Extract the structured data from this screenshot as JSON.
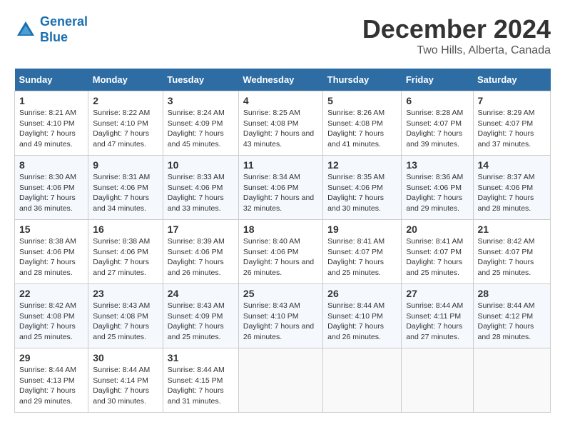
{
  "header": {
    "logo_line1": "General",
    "logo_line2": "Blue",
    "month": "December 2024",
    "location": "Two Hills, Alberta, Canada"
  },
  "days_of_week": [
    "Sunday",
    "Monday",
    "Tuesday",
    "Wednesday",
    "Thursday",
    "Friday",
    "Saturday"
  ],
  "weeks": [
    [
      {
        "day": "1",
        "sunrise": "8:21 AM",
        "sunset": "4:10 PM",
        "daylight": "7 hours and 49 minutes."
      },
      {
        "day": "2",
        "sunrise": "8:22 AM",
        "sunset": "4:10 PM",
        "daylight": "7 hours and 47 minutes."
      },
      {
        "day": "3",
        "sunrise": "8:24 AM",
        "sunset": "4:09 PM",
        "daylight": "7 hours and 45 minutes."
      },
      {
        "day": "4",
        "sunrise": "8:25 AM",
        "sunset": "4:08 PM",
        "daylight": "7 hours and 43 minutes."
      },
      {
        "day": "5",
        "sunrise": "8:26 AM",
        "sunset": "4:08 PM",
        "daylight": "7 hours and 41 minutes."
      },
      {
        "day": "6",
        "sunrise": "8:28 AM",
        "sunset": "4:07 PM",
        "daylight": "7 hours and 39 minutes."
      },
      {
        "day": "7",
        "sunrise": "8:29 AM",
        "sunset": "4:07 PM",
        "daylight": "7 hours and 37 minutes."
      }
    ],
    [
      {
        "day": "8",
        "sunrise": "8:30 AM",
        "sunset": "4:06 PM",
        "daylight": "7 hours and 36 minutes."
      },
      {
        "day": "9",
        "sunrise": "8:31 AM",
        "sunset": "4:06 PM",
        "daylight": "7 hours and 34 minutes."
      },
      {
        "day": "10",
        "sunrise": "8:33 AM",
        "sunset": "4:06 PM",
        "daylight": "7 hours and 33 minutes."
      },
      {
        "day": "11",
        "sunrise": "8:34 AM",
        "sunset": "4:06 PM",
        "daylight": "7 hours and 32 minutes."
      },
      {
        "day": "12",
        "sunrise": "8:35 AM",
        "sunset": "4:06 PM",
        "daylight": "7 hours and 30 minutes."
      },
      {
        "day": "13",
        "sunrise": "8:36 AM",
        "sunset": "4:06 PM",
        "daylight": "7 hours and 29 minutes."
      },
      {
        "day": "14",
        "sunrise": "8:37 AM",
        "sunset": "4:06 PM",
        "daylight": "7 hours and 28 minutes."
      }
    ],
    [
      {
        "day": "15",
        "sunrise": "8:38 AM",
        "sunset": "4:06 PM",
        "daylight": "7 hours and 28 minutes."
      },
      {
        "day": "16",
        "sunrise": "8:38 AM",
        "sunset": "4:06 PM",
        "daylight": "7 hours and 27 minutes."
      },
      {
        "day": "17",
        "sunrise": "8:39 AM",
        "sunset": "4:06 PM",
        "daylight": "7 hours and 26 minutes."
      },
      {
        "day": "18",
        "sunrise": "8:40 AM",
        "sunset": "4:06 PM",
        "daylight": "7 hours and 26 minutes."
      },
      {
        "day": "19",
        "sunrise": "8:41 AM",
        "sunset": "4:07 PM",
        "daylight": "7 hours and 25 minutes."
      },
      {
        "day": "20",
        "sunrise": "8:41 AM",
        "sunset": "4:07 PM",
        "daylight": "7 hours and 25 minutes."
      },
      {
        "day": "21",
        "sunrise": "8:42 AM",
        "sunset": "4:07 PM",
        "daylight": "7 hours and 25 minutes."
      }
    ],
    [
      {
        "day": "22",
        "sunrise": "8:42 AM",
        "sunset": "4:08 PM",
        "daylight": "7 hours and 25 minutes."
      },
      {
        "day": "23",
        "sunrise": "8:43 AM",
        "sunset": "4:08 PM",
        "daylight": "7 hours and 25 minutes."
      },
      {
        "day": "24",
        "sunrise": "8:43 AM",
        "sunset": "4:09 PM",
        "daylight": "7 hours and 25 minutes."
      },
      {
        "day": "25",
        "sunrise": "8:43 AM",
        "sunset": "4:10 PM",
        "daylight": "7 hours and 26 minutes."
      },
      {
        "day": "26",
        "sunrise": "8:44 AM",
        "sunset": "4:10 PM",
        "daylight": "7 hours and 26 minutes."
      },
      {
        "day": "27",
        "sunrise": "8:44 AM",
        "sunset": "4:11 PM",
        "daylight": "7 hours and 27 minutes."
      },
      {
        "day": "28",
        "sunrise": "8:44 AM",
        "sunset": "4:12 PM",
        "daylight": "7 hours and 28 minutes."
      }
    ],
    [
      {
        "day": "29",
        "sunrise": "8:44 AM",
        "sunset": "4:13 PM",
        "daylight": "7 hours and 29 minutes."
      },
      {
        "day": "30",
        "sunrise": "8:44 AM",
        "sunset": "4:14 PM",
        "daylight": "7 hours and 30 minutes."
      },
      {
        "day": "31",
        "sunrise": "8:44 AM",
        "sunset": "4:15 PM",
        "daylight": "7 hours and 31 minutes."
      },
      null,
      null,
      null,
      null
    ]
  ]
}
